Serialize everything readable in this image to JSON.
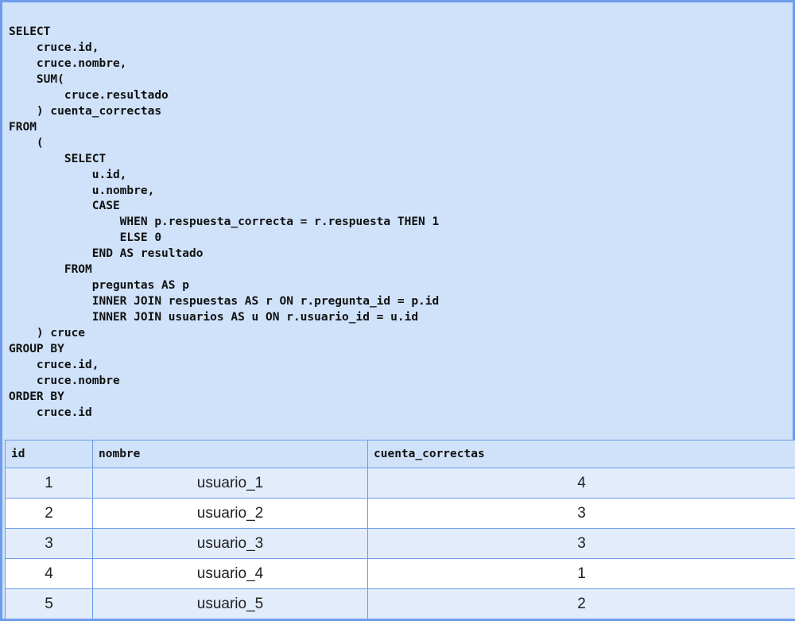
{
  "query": {
    "sql": "SELECT\n    cruce.id,\n    cruce.nombre,\n    SUM(\n        cruce.resultado\n    ) cuenta_correctas\nFROM\n    (\n        SELECT\n            u.id,\n            u.nombre,\n            CASE\n                WHEN p.respuesta_correcta = r.respuesta THEN 1\n                ELSE 0\n            END AS resultado\n        FROM\n            preguntas AS p\n            INNER JOIN respuestas AS r ON r.pregunta_id = p.id\n            INNER JOIN usuarios AS u ON r.usuario_id = u.id\n    ) cruce\nGROUP BY\n    cruce.id,\n    cruce.nombre\nORDER BY\n    cruce.id"
  },
  "results": {
    "columns": [
      "id",
      "nombre",
      "cuenta_correctas"
    ],
    "rows": [
      [
        "1",
        "usuario_1",
        "4"
      ],
      [
        "2",
        "usuario_2",
        "3"
      ],
      [
        "3",
        "usuario_3",
        "3"
      ],
      [
        "4",
        "usuario_4",
        "1"
      ],
      [
        "5",
        "usuario_5",
        "2"
      ]
    ]
  },
  "colors": {
    "border": "#6d9ceb",
    "panel_background": "#cfe2f9",
    "row_alt_background": "#e3ecfb",
    "row_background": "#ffffff"
  }
}
